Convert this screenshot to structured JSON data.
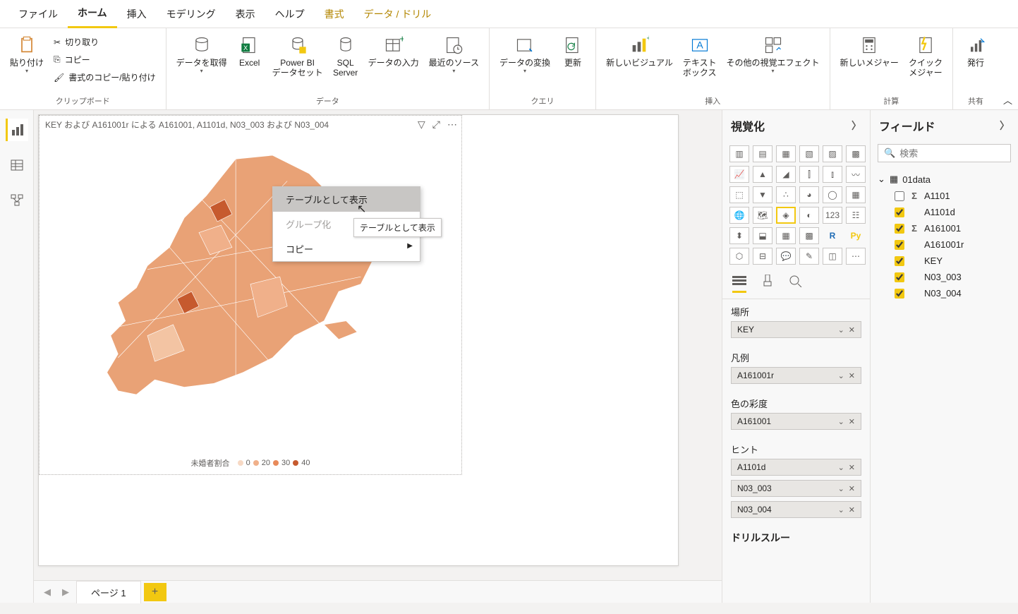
{
  "menubar": {
    "items": [
      "ファイル",
      "ホーム",
      "挿入",
      "モデリング",
      "表示",
      "ヘルプ",
      "書式",
      "データ / ドリル"
    ],
    "active_index": 1,
    "accent_indices": [
      6,
      7
    ]
  },
  "ribbon": {
    "clipboard": {
      "group_label": "クリップボード",
      "paste": "貼り付け",
      "cut": "切り取り",
      "copy": "コピー",
      "format_painter": "書式のコピー/貼り付け"
    },
    "data": {
      "group_label": "データ",
      "get_data": "データを取得",
      "excel": "Excel",
      "pbi_dataset": "Power BI\nデータセット",
      "sql": "SQL\nServer",
      "enter_data": "データの入力",
      "recent": "最近のソース"
    },
    "query": {
      "group_label": "クエリ",
      "transform": "データの変換",
      "refresh": "更新"
    },
    "insert": {
      "group_label": "挿入",
      "new_visual": "新しいビジュアル",
      "text_box": "テキスト\nボックス",
      "more_visuals": "その他の視覚エフェクト"
    },
    "calc": {
      "group_label": "計算",
      "new_measure": "新しいメジャー",
      "quick_measure": "クイック\nメジャー"
    },
    "share": {
      "group_label": "共有",
      "publish": "発行"
    }
  },
  "canvas": {
    "visual_title": "KEY および A161001r による A161001, A1101d, N03_003 および N03_004",
    "legend_title": "未婚者割合",
    "legend_items": [
      {
        "label": "0",
        "color": "#f7d9c4"
      },
      {
        "label": "20",
        "color": "#f0b08a"
      },
      {
        "label": "30",
        "color": "#e88a5a"
      },
      {
        "label": "40",
        "color": "#c65a2e"
      }
    ]
  },
  "context_menu": {
    "show_as_table": "テーブルとして表示",
    "group": "グループ化",
    "copy": "コピー",
    "tooltip": "テーブルとして表示"
  },
  "panels": {
    "viz_title": "視覚化",
    "fields_title": "フィールド",
    "search_placeholder": "検索",
    "wells": {
      "location_label": "場所",
      "location_value": "KEY",
      "legend_label": "凡例",
      "legend_value": "A161001r",
      "saturation_label": "色の彩度",
      "saturation_value": "A161001",
      "tooltips_label": "ヒント",
      "tooltip_values": [
        "A1101d",
        "N03_003",
        "N03_004"
      ]
    },
    "drillthrough": "ドリルスルー",
    "table_name": "01data",
    "fields": [
      {
        "name": "A1101",
        "checked": false,
        "sigma": true
      },
      {
        "name": "A1101d",
        "checked": true,
        "sigma": false
      },
      {
        "name": "A161001",
        "checked": true,
        "sigma": true
      },
      {
        "name": "A161001r",
        "checked": true,
        "sigma": false
      },
      {
        "name": "KEY",
        "checked": true,
        "sigma": false
      },
      {
        "name": "N03_003",
        "checked": true,
        "sigma": false
      },
      {
        "name": "N03_004",
        "checked": true,
        "sigma": false
      }
    ]
  },
  "page_tabs": {
    "page1": "ページ 1"
  }
}
